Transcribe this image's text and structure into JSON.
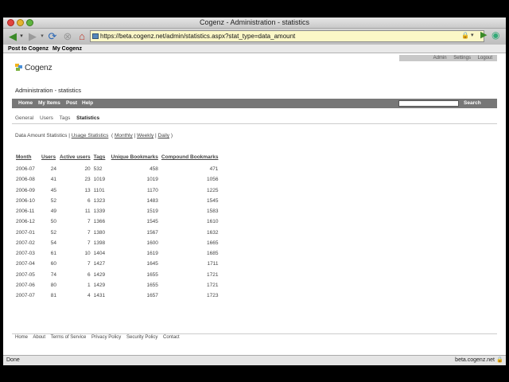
{
  "window": {
    "title": "Cogenz - Administration - statistics"
  },
  "browser": {
    "url": "https://beta.cogenz.net/admin/statistics.aspx?stat_type=data_amount",
    "bookmarks": [
      "Post to Cogenz",
      "My Cogenz"
    ],
    "status": "Done",
    "status_host": "beta.cogenz.net"
  },
  "site": {
    "top_links": [
      "Admin",
      "Settings",
      "Logout"
    ],
    "logo_text": "Cogenz",
    "logo_colors": [
      "#f2b21a",
      "#4a90d9",
      "#7cb342"
    ],
    "page_title": "Administration - statistics",
    "nav": [
      "Home",
      "My Items",
      "Post",
      "Help"
    ],
    "search_button": "Search",
    "subtabs": [
      "General",
      "Users",
      "Tags",
      "Statistics"
    ],
    "stat_types": {
      "current": "Data Amount Statistics",
      "sep": "|",
      "usage": "Usage Statistics",
      "open_paren": "(",
      "monthly": "Monthly",
      "weekly": "Weekly",
      "daily": "Daily",
      "close_paren": ")"
    },
    "table": {
      "headers": [
        "Month",
        "Users",
        "Active users",
        "Tags",
        "Unique Bookmarks",
        "Compound Bookmarks"
      ],
      "rows": [
        [
          "2006-07",
          "24",
          "20",
          "532",
          "458",
          "471"
        ],
        [
          "2006-08",
          "41",
          "23",
          "1019",
          "1019",
          "1056"
        ],
        [
          "2006-09",
          "45",
          "13",
          "1101",
          "1170",
          "1225"
        ],
        [
          "2006-10",
          "52",
          "6",
          "1323",
          "1483",
          "1545"
        ],
        [
          "2006-11",
          "49",
          "11",
          "1339",
          "1519",
          "1583"
        ],
        [
          "2006-12",
          "50",
          "7",
          "1366",
          "1545",
          "1610"
        ],
        [
          "2007-01",
          "52",
          "7",
          "1380",
          "1567",
          "1632"
        ],
        [
          "2007-02",
          "54",
          "7",
          "1398",
          "1600",
          "1665"
        ],
        [
          "2007-03",
          "61",
          "10",
          "1404",
          "1619",
          "1685"
        ],
        [
          "2007-04",
          "60",
          "7",
          "1427",
          "1645",
          "1711"
        ],
        [
          "2007-05",
          "74",
          "6",
          "1429",
          "1655",
          "1721"
        ],
        [
          "2007-06",
          "80",
          "1",
          "1429",
          "1655",
          "1721"
        ],
        [
          "2007-07",
          "81",
          "4",
          "1431",
          "1657",
          "1723"
        ]
      ]
    },
    "footer": [
      "Home",
      "About",
      "Terms of Service",
      "Privacy Policy",
      "Security Policy",
      "Contact"
    ]
  }
}
